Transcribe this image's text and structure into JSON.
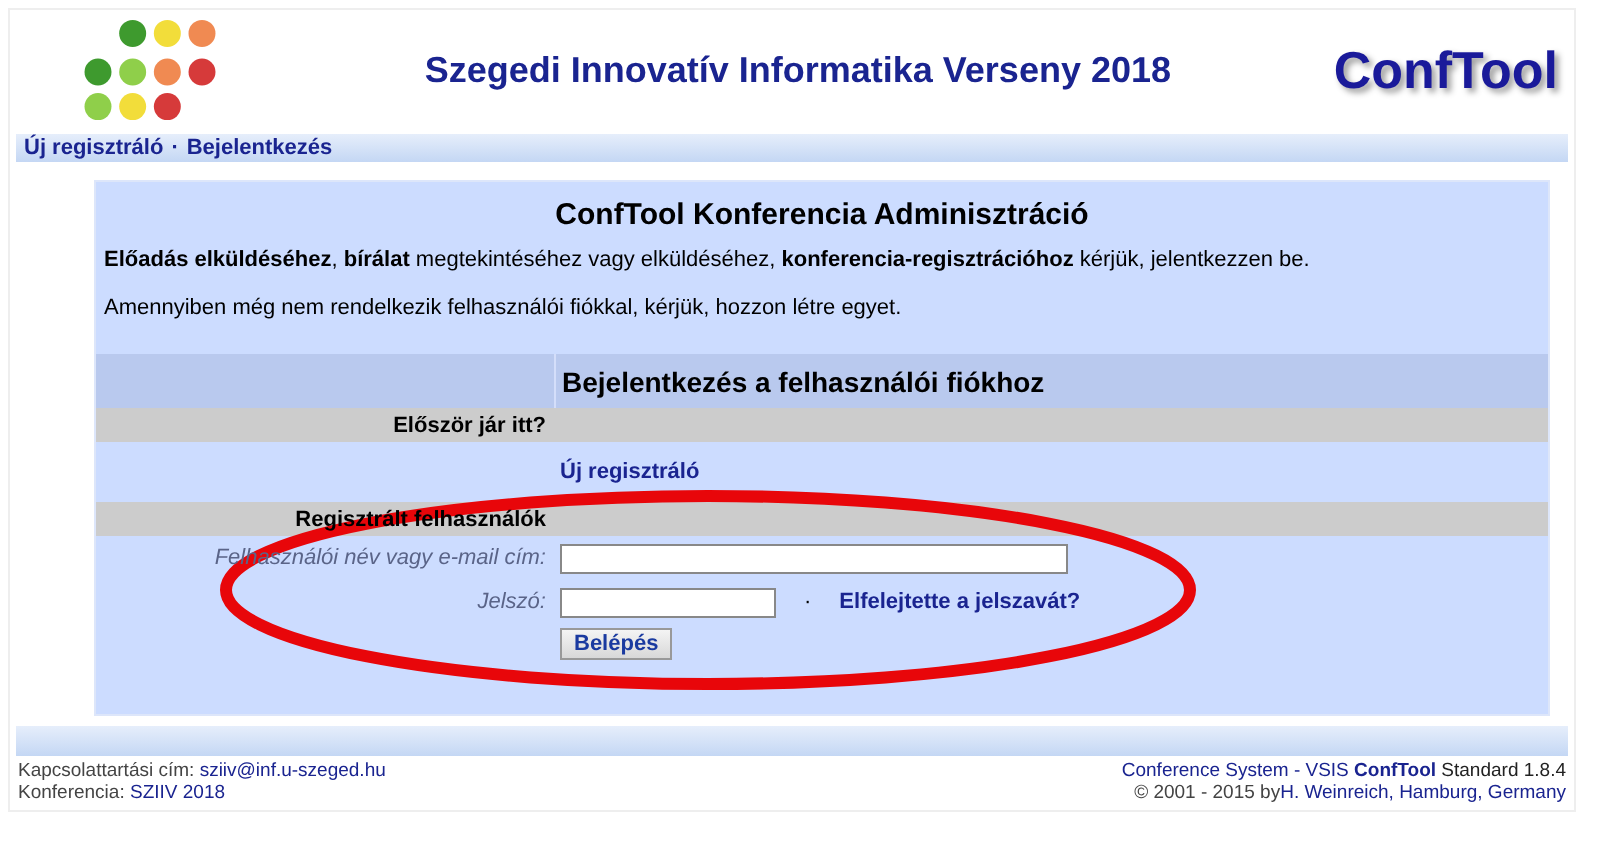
{
  "header": {
    "title": "Szegedi Innovatív Informatika Verseny 2018",
    "brand": "ConfTool"
  },
  "nav": {
    "items": [
      "Új regisztráló",
      "Bejelentkezés"
    ],
    "separator": "·"
  },
  "intro": {
    "heading": "ConfTool Konferencia Adminisztráció",
    "paragraphs": [
      "**Előadás elküldéséhez**, **bírálat** megtekintéséhez vagy elküldéséhez, **konferencia-regisztrációhoz** kérjük, jelentkezzen be.",
      "Amennyiben még nem rendelkezik felhasználói fiókkal, kérjük, hozzon létre egyet."
    ]
  },
  "login": {
    "heading": "Bejelentkezés a felhasználói fiókhoz",
    "first_visit": {
      "label": "Először jár itt?",
      "link": "Új regisztráló"
    },
    "registered": {
      "label": "Regisztrált felhasználók"
    },
    "fields": [
      {
        "label": "Felhasználói név vagy e-mail cím:",
        "kind": "username"
      },
      {
        "label": "Jelszó:",
        "kind": "password"
      }
    ],
    "separator": "·",
    "forgot_link": "Elfelejtette a jelszavát?",
    "submit": "Belépés"
  },
  "footer": {
    "contact_label": "Kapcsolattartási cím:",
    "contact_email": "sziiv@inf.u-szeged.hu",
    "conference_label": "Konferencia:",
    "conference_link": "SZIIV 2018",
    "system_link": "Conference System - VSIS",
    "credit": "**ConfTool** Standard 1.8.4",
    "copyright": "© 2001 - 2015 by",
    "author_link": "H. Weinreich, Hamburg, Germany"
  }
}
